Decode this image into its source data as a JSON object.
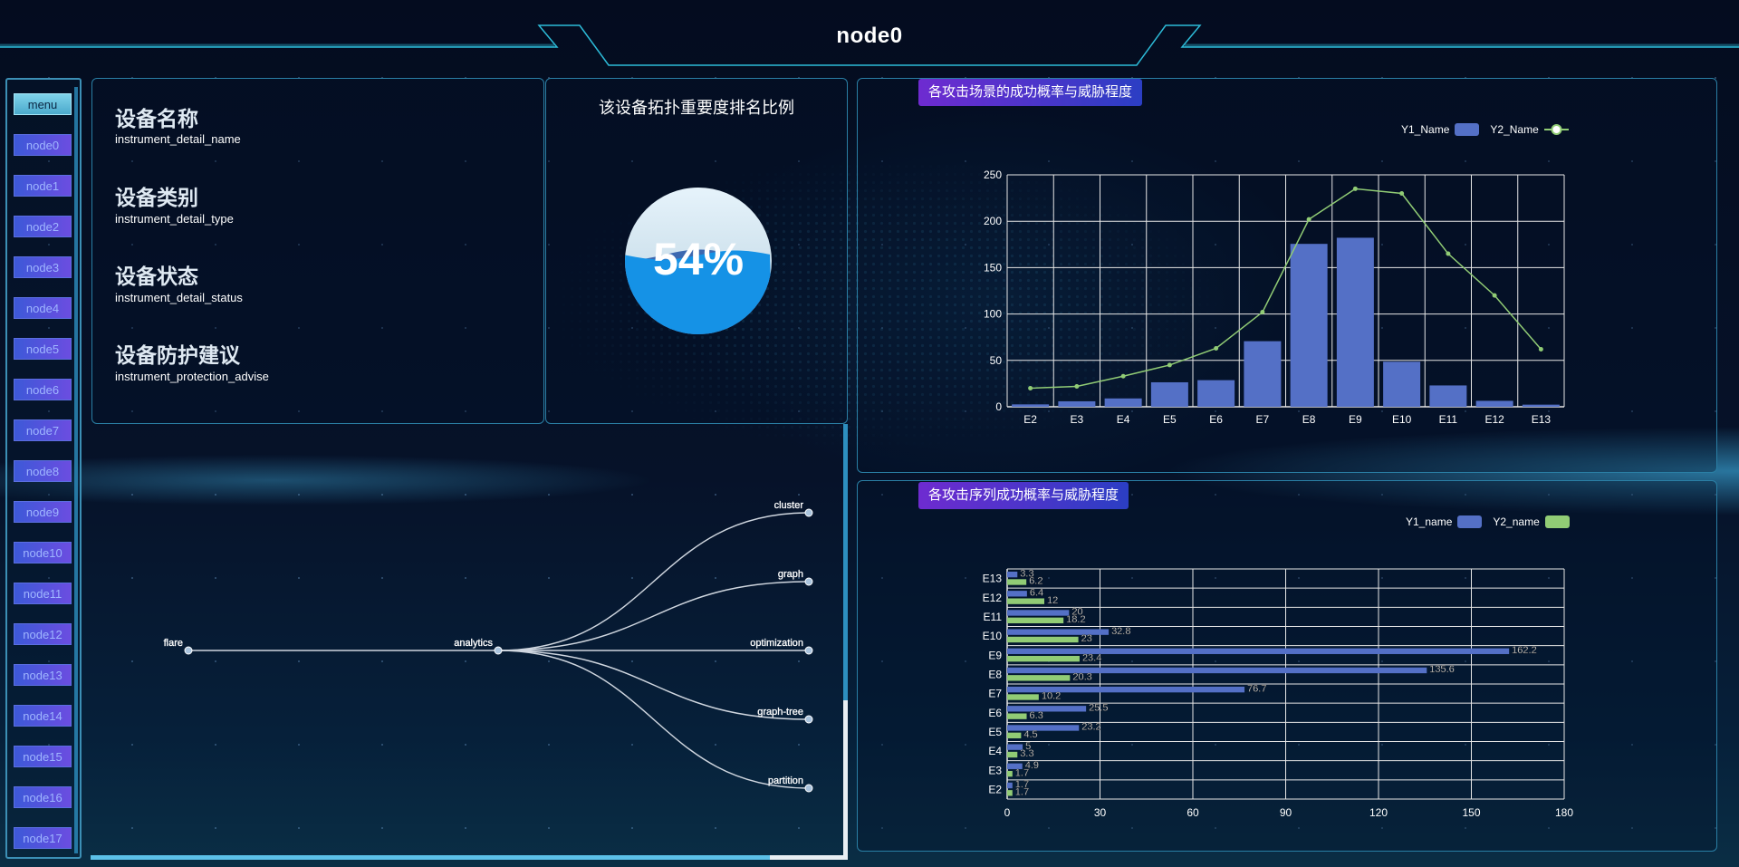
{
  "header": {
    "title": "node0"
  },
  "sidebar": {
    "menu_label": "menu",
    "items": [
      "node0",
      "node1",
      "node2",
      "node3",
      "node4",
      "node5",
      "node6",
      "node7",
      "node8",
      "node9",
      "node10",
      "node11",
      "node12",
      "node13",
      "node14",
      "node15",
      "node16",
      "node17"
    ]
  },
  "device_info": [
    {
      "label": "设备名称",
      "value": "instrument_detail_name"
    },
    {
      "label": "设备类别",
      "value": "instrument_detail_type"
    },
    {
      "label": "设备状态",
      "value": "instrument_detail_status"
    },
    {
      "label": "设备防护建议",
      "value": "instrument_protection_advise"
    }
  ],
  "ranking": {
    "title": "该设备拓扑重要度排名比例",
    "percent_text": "54%",
    "value": 0.54
  },
  "tree": {
    "root": "flare",
    "child": "analytics",
    "leaves": [
      "cluster",
      "graph",
      "optimization",
      "graph-tree",
      "partition"
    ]
  },
  "colors": {
    "bar": "#5470c6",
    "line": "#91cc75",
    "accent": "#2a7fa5"
  },
  "chart_data": [
    {
      "type": "bar",
      "title": "各攻击场景的成功概率与威胁程度",
      "categories": [
        "E2",
        "E3",
        "E4",
        "E5",
        "E6",
        "E7",
        "E8",
        "E9",
        "E10",
        "E11",
        "E12",
        "E13"
      ],
      "series": [
        {
          "name": "Y1_Name",
          "type": "bar",
          "values": [
            2.6,
            5.9,
            9.0,
            26.4,
            28.7,
            70.7,
            175.6,
            182.2,
            48.6,
            23.0,
            6.4,
            2.3
          ]
        },
        {
          "name": "Y2_Name",
          "type": "line",
          "values": [
            20,
            22,
            33,
            45,
            63,
            102,
            202,
            235,
            230,
            165,
            120,
            62
          ]
        }
      ],
      "ylim": [
        0,
        250
      ],
      "yticks": [
        0,
        50,
        100,
        150,
        200,
        250
      ],
      "legend": "top-right",
      "grid": true
    },
    {
      "type": "bar",
      "orientation": "horizontal",
      "title": "各攻击序列成功概率与威胁程度",
      "categories": [
        "E2",
        "E3",
        "E4",
        "E5",
        "E6",
        "E7",
        "E8",
        "E9",
        "E10",
        "E11",
        "E12",
        "E13"
      ],
      "series": [
        {
          "name": "Y1_name",
          "values": [
            1.7,
            4.9,
            5,
            23.2,
            25.5,
            76.7,
            135.6,
            162.2,
            32.8,
            20,
            6.4,
            3.3
          ]
        },
        {
          "name": "Y2_name",
          "values": [
            1.7,
            1.7,
            3.3,
            4.5,
            6.3,
            10.2,
            20.3,
            23.4,
            23,
            18.2,
            12,
            6.2
          ]
        }
      ],
      "xlim": [
        0,
        180
      ],
      "xticks": [
        0,
        30,
        60,
        90,
        120,
        150,
        180
      ],
      "legend": "top-right",
      "grid": true
    }
  ]
}
